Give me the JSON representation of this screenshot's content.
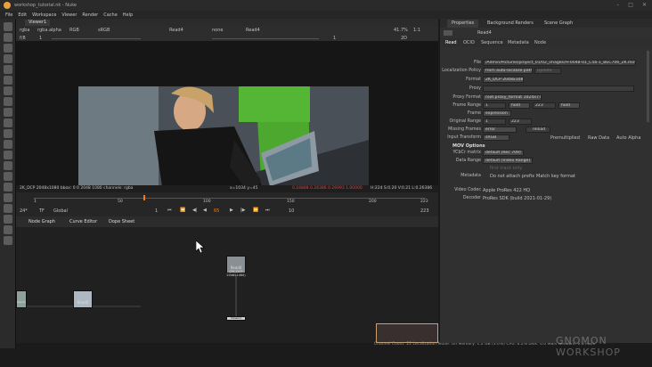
{
  "window": {
    "title": "workshop_tutorial.nk - Nuke"
  },
  "menu": [
    "File",
    "Edit",
    "Workspace",
    "Viewer",
    "Render",
    "Cache",
    "Help"
  ],
  "viewer": {
    "tab_label": "Viewer1",
    "layer": "rgba",
    "channel": "rgba.alpha",
    "colorspace_mode": "RGB",
    "colorspace": "sRGB",
    "input_a": "Read4",
    "input_b": "none",
    "input_c": "Read4",
    "zoom": "41.7%",
    "ratio": "1:1",
    "frame_display": "2D",
    "f_stop": "f/8",
    "gain_value": "1",
    "gamma_value": "0",
    "y_value": "1",
    "info": {
      "format": "2K_DCP 2048x1080  bbox: 0 0 2048 1080  channels: rgba",
      "coords": "x=1034 y=45",
      "pixel": "0.24888  0.26386  0.26993  1.00000",
      "hsv": "H:224 S:0.20 V:0.21  L:0.26386"
    }
  },
  "timeline": {
    "fps": "24*",
    "mode": "TF",
    "range": "Global",
    "ticks": [
      "1",
      "50",
      "100",
      "150",
      "200",
      "223"
    ],
    "start": "1",
    "end": "223",
    "current_frame": "65",
    "increment": "10"
  },
  "nodegraph": {
    "tabs": [
      "Node Graph",
      "Curve Editor",
      "Dope Sheet"
    ],
    "nodes": [
      {
        "label": "Read4",
        "sub": "(2K_DCP 2048x1080)"
      },
      {
        "label": "Read3",
        "sub": ""
      },
      {
        "label": "Read2",
        "sub": ""
      },
      {
        "label": "Viewer1",
        "sub": ""
      }
    ]
  },
  "status": "Channel Count: 22  Localization Mode: On  Memory: 1.2 GB (3.0%)  CPU: 6.2%  Disk: 0.0 MB/s  Network: 0.0 MB/s",
  "properties": {
    "tabs": [
      "Properties",
      "Background Renders",
      "Scene Graph"
    ],
    "node_name": "Read4",
    "sub_tabs": [
      "Read",
      "OCIO",
      "Sequence",
      "Metadata",
      "Node"
    ],
    "file": "/Admin/Pictures/project_01/02_images/FF0048-01_C5b-1_BEC706_2K.mov",
    "localization_policy": "from auto-localize path",
    "update_label": "Update",
    "format": "2K_DCP 2048x1080",
    "proxy": "",
    "proxy_format": "root.proxy_format 1024x778",
    "frame_range_start": "1",
    "frame_range_before": "hold",
    "frame_range_end": "223",
    "frame_range_after": "hold",
    "frame_mode": "expression",
    "original_range_start": "1",
    "original_range_end": "223",
    "missing_frames": "error",
    "reload_label": "reload",
    "input_transform": "sRGB",
    "premultiplied_label": "Premultiplied",
    "raw_data_label": "Raw Data",
    "auto_alpha_label": "Auto Alpha",
    "mov_options_heading": "MOV Options",
    "ycbcr_matrix": "default (Rec 709)",
    "data_range": "default (Video Range)",
    "first_track_only_label": "first track only",
    "metadata_label": "Metadata",
    "do_not_attach_prefix_label": "Do not attach prefix",
    "match_key_format_label": "Match key format",
    "video_codec": "Apple ProRes 422 HQ",
    "decoder": "ProRes SDK (build 2021-01-29)"
  },
  "labels": {
    "file": "File",
    "localization_policy": "Localization Policy",
    "format": "Format",
    "proxy": "Proxy",
    "proxy_format": "Proxy Format",
    "frame_range": "Frame Range",
    "frame": "Frame",
    "original_range": "Original Range",
    "missing_frames": "Missing Frames",
    "input_transform": "Input Transform",
    "ycbcr_matrix": "YCbCr matrix",
    "data_range": "Data Range",
    "video_codec": "Video Codec",
    "decoder": "Decoder"
  },
  "watermark": {
    "line1": "GNOMON",
    "line2": "WORKSHOP"
  },
  "colors": {
    "accent": "#e8a13a",
    "frame_marker": "#ff7a00",
    "selection": "#c8a070"
  }
}
